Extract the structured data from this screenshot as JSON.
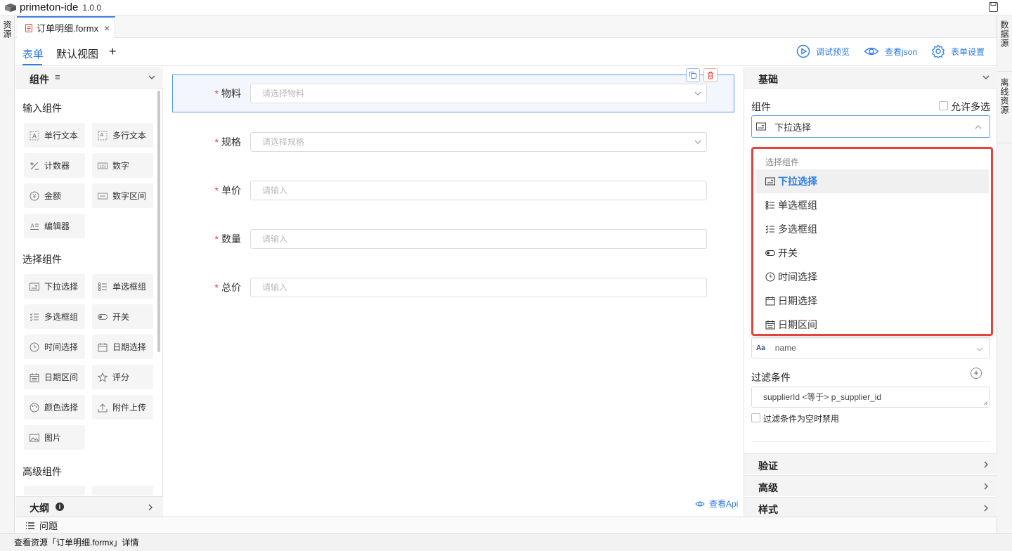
{
  "app": {
    "name": "primeton-ide",
    "version": "1.0.0"
  },
  "left_rail": {
    "label": "资源"
  },
  "right_rail": {
    "label1": "数据源",
    "label2": "离线资源"
  },
  "file_tab": {
    "name": "订单明细.formx",
    "close": "×"
  },
  "editor_tabs": {
    "items": [
      "表单",
      "默认视图"
    ],
    "add": "+"
  },
  "toolbar": {
    "preview": "调试预览",
    "json": "查看json",
    "settings": "表单设置"
  },
  "palette": {
    "title": "组件",
    "menu_glyph": "≡",
    "groups": {
      "input": "输入组件",
      "select": "选择组件",
      "advanced": "高级组件"
    },
    "input_items": [
      "单行文本",
      "多行文本",
      "计数器",
      "数字",
      "金额",
      "数字区间",
      "编辑器"
    ],
    "select_items": [
      "下拉选择",
      "单选框组",
      "多选框组",
      "开关",
      "时间选择",
      "日期选择",
      "日期区间",
      "评分",
      "颜色选择",
      "附件上传",
      "图片"
    ],
    "outline": "大纲",
    "outline_info": "i"
  },
  "form": {
    "fields": [
      {
        "label": "物料",
        "placeholder": "请选择物料",
        "required": "*"
      },
      {
        "label": "规格",
        "placeholder": "请选择规格",
        "required": "*"
      },
      {
        "label": "单价",
        "placeholder": "请输入",
        "required": "*"
      },
      {
        "label": "数量",
        "placeholder": "请输入",
        "required": "*"
      },
      {
        "label": "总价",
        "placeholder": "请输入",
        "required": "*"
      }
    ],
    "api_link": "查看Api"
  },
  "props": {
    "section_basic": "基础",
    "component_label": "组件",
    "allow_multi": "允许多选",
    "selected_component": "下拉选择",
    "dropdown": {
      "group": "选择组件",
      "items": [
        "下拉选择",
        "单选框组",
        "多选框组",
        "开关",
        "时间选择",
        "日期选择",
        "日期区间"
      ]
    },
    "name_prefix": "Aa",
    "name_value": "name",
    "filter_label": "过滤条件",
    "filter_add": "+",
    "filter_value": "supplierId <等于> p_supplier_id",
    "filter_disable": "过滤条件为空时禁用",
    "sections": [
      "验证",
      "高级",
      "样式"
    ]
  },
  "problems": {
    "label": "问题"
  },
  "status": {
    "text": "查看资源「订单明细.formx」详情"
  },
  "colors": {
    "accent": "#2f7de1",
    "required": "#e0443a",
    "highlight_border": "#e0443a"
  }
}
